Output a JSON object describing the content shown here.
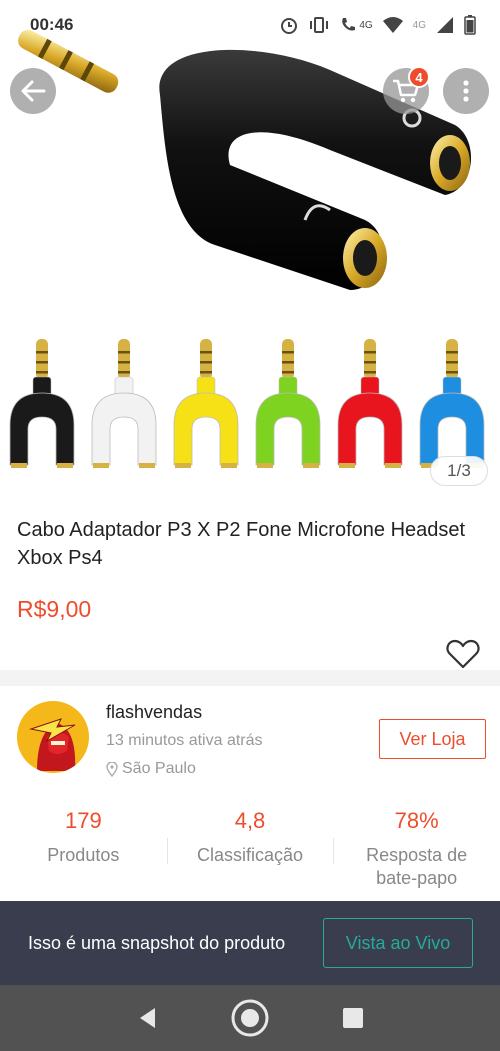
{
  "status_bar": {
    "time": "00:46",
    "network_label_1": "4G",
    "network_label_2": "4G"
  },
  "header": {
    "cart_count": "4",
    "icons": [
      "back-arrow-icon",
      "cart-icon",
      "more-vertical-icon"
    ]
  },
  "gallery": {
    "counter": "1/3",
    "variant_colors": [
      "#1a1a1a",
      "#f2f2f2",
      "#f6e016",
      "#7ed321",
      "#e8141e",
      "#1e8fe0"
    ]
  },
  "product": {
    "title": "Cabo Adaptador P3 X P2 Fone Microfone Headset Xbox Ps4",
    "price": "R$9,00"
  },
  "shop": {
    "name": "flashvendas",
    "active": "13 minutos ativa atrás",
    "location": "São Paulo",
    "visit_label": "Ver Loja",
    "stats": [
      {
        "value": "179",
        "label": "Produtos"
      },
      {
        "value": "4,8",
        "label": "Classificação"
      },
      {
        "value": "78%",
        "label": "Resposta de bate-papo"
      }
    ]
  },
  "snapshot": {
    "text": "Isso é uma snapshot do produto",
    "live_label": "Vista ao Vivo"
  },
  "colors": {
    "accent": "#ee4d2d",
    "teal": "#26aa99",
    "snapshot_bg": "#3a3d4d"
  }
}
